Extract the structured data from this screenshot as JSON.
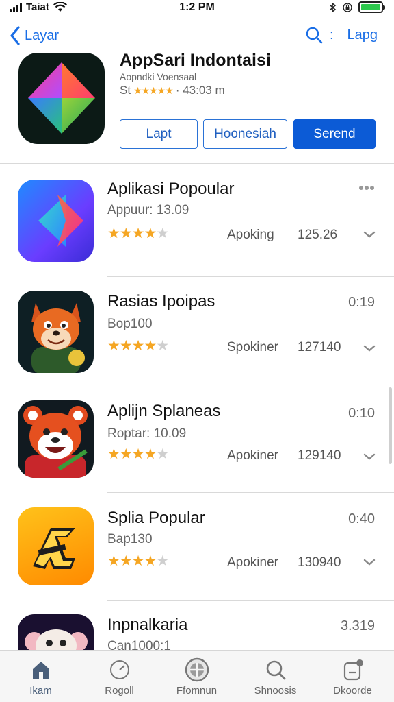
{
  "status_bar": {
    "carrier": "Taiat",
    "time": "1:2 PM",
    "battery_color": "#2dc84d"
  },
  "nav": {
    "back_label": "Layar",
    "colon": ":",
    "right_label": "Lapg"
  },
  "hero": {
    "title": "AppSari Indontaisi",
    "subtitle": "Aopndki Voensaal",
    "meta_prefix": "St",
    "meta_stars": "★★★★★",
    "meta_text": "· 43:03 m",
    "buttons": {
      "left": "Lapt",
      "middle": "Hoonesiah",
      "right": "Serend"
    }
  },
  "apps": [
    {
      "title": "Aplikasi Popoular",
      "subtitle": "Appuur: 13.09",
      "rating": 4,
      "status": "Apoking",
      "count": "125.26",
      "time": "",
      "has_more": true
    },
    {
      "title": "Rasias Ipoipas",
      "subtitle": "Bop100",
      "rating": 4,
      "status": "Spokiner",
      "count": "127140",
      "time": "0:19",
      "has_more": false
    },
    {
      "title": "Aplijn Splaneas",
      "subtitle": "Roptar: 10.09",
      "rating": 4,
      "status": "Apokiner",
      "count": "129140",
      "time": "0:10",
      "has_more": false
    },
    {
      "title": "Splia Popular",
      "subtitle": "Bap130",
      "rating": 4,
      "status": "Apokiner",
      "count": "130940",
      "time": "0:40",
      "has_more": false
    },
    {
      "title": "Inpnalkaria",
      "subtitle": "Can1000:1",
      "time": "3.319"
    }
  ],
  "tabs": [
    {
      "label": "Ikam",
      "icon": "home-icon",
      "active": true
    },
    {
      "label": "Rogoll",
      "icon": "clock-icon",
      "active": false
    },
    {
      "label": "Ffomnun",
      "icon": "globe-icon",
      "active": false
    },
    {
      "label": "Shnoosis",
      "icon": "search-icon",
      "active": false
    },
    {
      "label": "Dkoorde",
      "icon": "updates-icon",
      "active": false
    }
  ],
  "colors": {
    "accent": "#0c5bd6",
    "link": "#1a6ee6",
    "star": "#f5a623"
  }
}
